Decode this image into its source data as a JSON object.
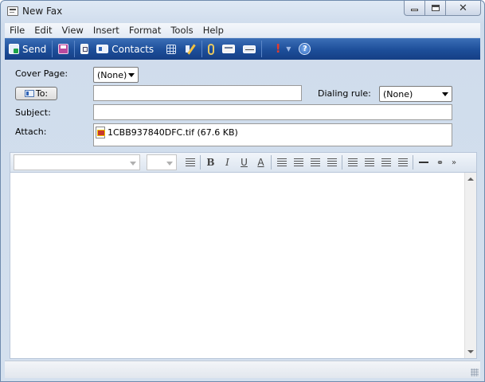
{
  "window": {
    "title": "New Fax"
  },
  "menu": [
    "File",
    "Edit",
    "View",
    "Insert",
    "Format",
    "Tools",
    "Help"
  ],
  "toolbar": {
    "send": "Send",
    "contacts": "Contacts",
    "help_glyph": "?",
    "priority_glyph": "!"
  },
  "form": {
    "cover_page_label": "Cover Page:",
    "cover_page_value": "(None)",
    "to_button": "To:",
    "to_value": "",
    "dialing_rule_label": "Dialing rule:",
    "dialing_rule_value": "(None)",
    "subject_label": "Subject:",
    "subject_value": "",
    "attach_label": "Attach:",
    "attachment": "1CBB937840DFC.tif (67.6 KB)"
  },
  "format_toolbar": {
    "bold": "B",
    "italic": "I",
    "underline": "U",
    "font_color": "A",
    "more": "»"
  },
  "colors": {
    "toolbar_blue": "#1d4e99",
    "accent": "#3c6fb7"
  }
}
